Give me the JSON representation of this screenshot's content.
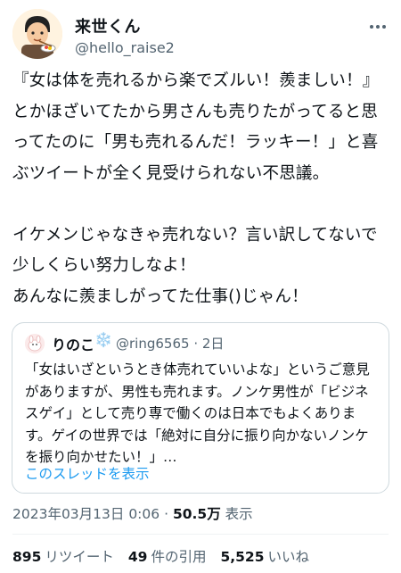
{
  "author": {
    "display_name": "来世くん",
    "handle": "@hello_raise2"
  },
  "tweet": {
    "text": "『女は体を売れるから楽でズルい！羨ましい！』とかほざいてたから男さんも売りたがってると思ってたのに「男も売れるんだ！ラッキー！」と喜ぶツイートが全く見受けられない不思議。\n\nイケメンじゃなきゃ売れない？言い訳してないで少しくらい努力しなよ！\nあんなに羨ましがってた仕事()じゃん！",
    "timestamp": "2023年03月13日 0:06",
    "separator": "·",
    "views_count": "50.5万",
    "views_label": "表示"
  },
  "quoted_tweet": {
    "display_name": "りのこ",
    "emoji": "❄️",
    "handle": "@ring6565",
    "separator": "·",
    "age": "2日",
    "text": "「女はいざというとき体売れていいよな」というご意見がありますが、男性も売れます。ノンケ男性が「ビジネスゲイ」として売り専で働くのは日本でもよくあります。ゲイの世界では「絶対に自分に振り向かないノンケを振り向かせたい！」…",
    "thread_link": "このスレッドを表示"
  },
  "stats": {
    "retweets_count": "895",
    "retweets_label": "リツイート",
    "quotes_count": "49",
    "quotes_label": "件の引用",
    "likes_count": "5,525",
    "likes_label": "いいね"
  },
  "colors": {
    "text": "#0f1419",
    "secondary": "#536471",
    "link": "#1d9bf0",
    "border": "#cfd9de"
  }
}
